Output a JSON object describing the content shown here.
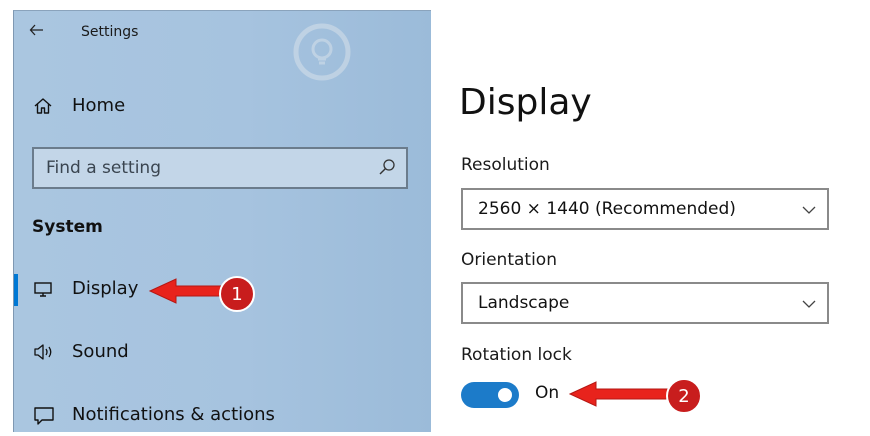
{
  "window": {
    "title": "Settings"
  },
  "sidebar": {
    "home_label": "Home",
    "search_placeholder": "Find a setting",
    "section_heading": "System",
    "items": [
      {
        "label": "Display",
        "icon": "monitor-icon",
        "selected": true
      },
      {
        "label": "Sound",
        "icon": "speaker-icon",
        "selected": false
      },
      {
        "label": "Notifications & actions",
        "icon": "chat-bubble-icon",
        "selected": false
      }
    ]
  },
  "main": {
    "title": "Display",
    "resolution": {
      "label": "Resolution",
      "value": "2560 × 1440 (Recommended)"
    },
    "orientation": {
      "label": "Orientation",
      "value": "Landscape"
    },
    "rotation_lock": {
      "label": "Rotation lock",
      "state_text": "On",
      "enabled": true
    }
  },
  "annotations": {
    "markers": [
      "1",
      "2"
    ],
    "arrow_color": "#e8231c",
    "badge_color": "#c81d1d"
  },
  "colors": {
    "accent": "#1c7bc9",
    "sidebar_bg": "#a6c3df"
  }
}
